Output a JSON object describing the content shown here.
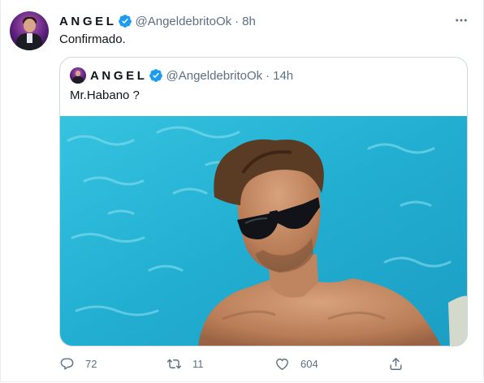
{
  "tweet": {
    "author_name": "ANGEL",
    "handle": "@AngeldebritoOk",
    "separator": "·",
    "time": "8h",
    "text": "Confirmado."
  },
  "quoted": {
    "author_name": "ANGEL",
    "handle": "@AngeldebritoOk",
    "separator": "·",
    "time": "14h",
    "text": "Mr.Habano ?"
  },
  "actions": {
    "replies": "72",
    "retweets": "11",
    "likes": "604"
  },
  "colors": {
    "verified": "#1d9bf0",
    "secondary_text": "#5b7083",
    "border": "#cfd9de",
    "pool_water": "#29b7d6"
  },
  "icons": [
    "more-icon",
    "verified-icon",
    "reply-icon",
    "retweet-icon",
    "like-icon",
    "share-icon"
  ]
}
